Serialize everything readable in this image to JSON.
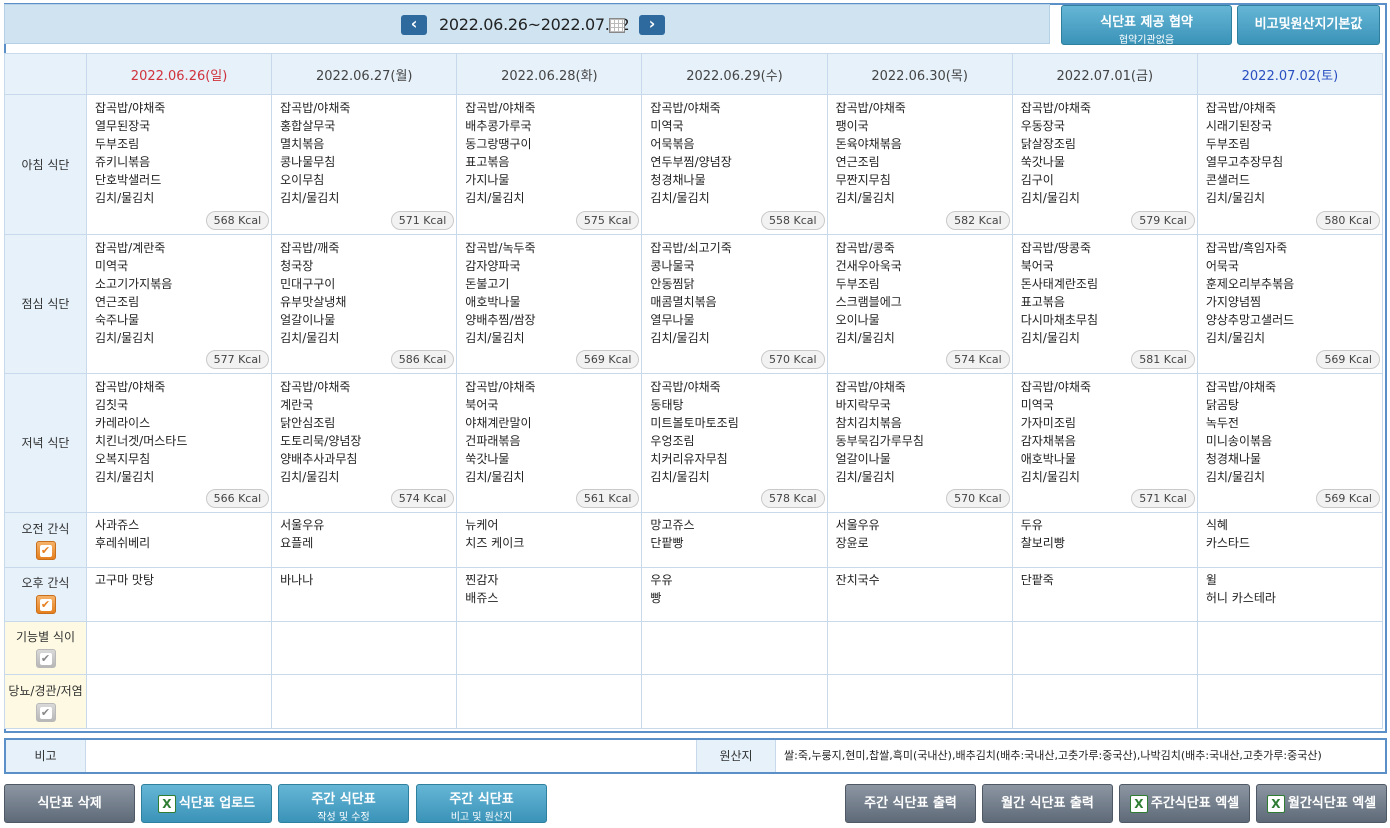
{
  "header": {
    "prev_label": "‹",
    "next_label": "›",
    "date_range": "2022.06.26~2022.07.02",
    "contract_button": {
      "line1": "식단표 제공 협약",
      "line2": "협약기관없음"
    },
    "remarks_default_button": "비고및원산지기본값"
  },
  "days": [
    {
      "label": "2022.06.26(일)",
      "type": "sun"
    },
    {
      "label": "2022.06.27(월)",
      "type": "weekday"
    },
    {
      "label": "2022.06.28(화)",
      "type": "weekday"
    },
    {
      "label": "2022.06.29(수)",
      "type": "weekday"
    },
    {
      "label": "2022.06.30(목)",
      "type": "weekday"
    },
    {
      "label": "2022.07.01(금)",
      "type": "weekday"
    },
    {
      "label": "2022.07.02(토)",
      "type": "sat"
    }
  ],
  "rows": {
    "breakfast": {
      "label": "아침 식단",
      "cells": [
        {
          "items": [
            "잡곡밥/야채죽",
            "열무된장국",
            "두부조림",
            "쥬키니볶음",
            "단호박샐러드",
            "김치/물김치"
          ],
          "kcal": "568 Kcal"
        },
        {
          "items": [
            "잡곡밥/야채죽",
            "홍합살무국",
            "멸치볶음",
            "콩나물무침",
            "오이무침",
            "김치/물김치"
          ],
          "kcal": "571 Kcal"
        },
        {
          "items": [
            "잡곡밥/야채죽",
            "배추콩가루국",
            "동그랑땡구이",
            "표고볶음",
            "가지나물",
            "김치/물김치"
          ],
          "kcal": "575 Kcal"
        },
        {
          "items": [
            "잡곡밥/야채죽",
            "미역국",
            "어묵볶음",
            "연두부찜/양념장",
            "청경채나물",
            "김치/물김치"
          ],
          "kcal": "558 Kcal"
        },
        {
          "items": [
            "잡곡밥/야채죽",
            "팽이국",
            "돈육야채볶음",
            "연근조림",
            "무짠지무침",
            "김치/물김치"
          ],
          "kcal": "582 Kcal"
        },
        {
          "items": [
            "잡곡밥/야채죽",
            "우동장국",
            "닭살장조림",
            "쑥갓나물",
            "김구이",
            "김치/물김치"
          ],
          "kcal": "579 Kcal"
        },
        {
          "items": [
            "잡곡밥/야채죽",
            "시래기된장국",
            "두부조림",
            "열무고추장무침",
            "콘샐러드",
            "김치/물김치"
          ],
          "kcal": "580 Kcal"
        }
      ]
    },
    "lunch": {
      "label": "점심 식단",
      "cells": [
        {
          "items": [
            "잡곡밥/계란죽",
            "미역국",
            "소고기가지볶음",
            "연근조림",
            "숙주나물",
            "김치/물김치"
          ],
          "kcal": "577 Kcal"
        },
        {
          "items": [
            "잡곡밥/깨죽",
            "청국장",
            "민대구구이",
            "유부맛살냉채",
            "얼갈이나물",
            "김치/물김치"
          ],
          "kcal": "586 Kcal"
        },
        {
          "items": [
            "잡곡밥/녹두죽",
            "감자양파국",
            "돈불고기",
            "애호박나물",
            "양배추찜/쌈장",
            "김치/물김치"
          ],
          "kcal": "569 Kcal"
        },
        {
          "items": [
            "잡곡밥/쇠고기죽",
            "콩나물국",
            "안동찜닭",
            "매콤멸치볶음",
            "열무나물",
            "김치/물김치"
          ],
          "kcal": "570 Kcal"
        },
        {
          "items": [
            "잡곡밥/콩죽",
            "건새우아욱국",
            "두부조림",
            "스크램블에그",
            "오이나물",
            "김치/물김치"
          ],
          "kcal": "574 Kcal"
        },
        {
          "items": [
            "잡곡밥/땅콩죽",
            "북어국",
            "돈사태계란조림",
            "표고볶음",
            "다시마채초무침",
            "김치/물김치"
          ],
          "kcal": "581 Kcal"
        },
        {
          "items": [
            "잡곡밥/흑임자죽",
            "어묵국",
            "훈제오리부추볶음",
            "가지양념찜",
            "양상추망고샐러드",
            "김치/물김치"
          ],
          "kcal": "569 Kcal"
        }
      ]
    },
    "dinner": {
      "label": "저녁 식단",
      "cells": [
        {
          "items": [
            "잡곡밥/야채죽",
            "김칫국",
            "카레라이스",
            "치킨너겟/머스타드",
            "오복지무침",
            "김치/물김치"
          ],
          "kcal": "566 Kcal"
        },
        {
          "items": [
            "잡곡밥/야채죽",
            "계란국",
            "닭안심조림",
            "도토리묵/양념장",
            "양배추사과무침",
            "김치/물김치"
          ],
          "kcal": "574 Kcal"
        },
        {
          "items": [
            "잡곡밥/야채죽",
            "북어국",
            "야채계란말이",
            "건파래볶음",
            "쑥갓나물",
            "김치/물김치"
          ],
          "kcal": "561 Kcal"
        },
        {
          "items": [
            "잡곡밥/야채죽",
            "동태탕",
            "미트볼토마토조림",
            "우엉조림",
            "치커리유자무침",
            "김치/물김치"
          ],
          "kcal": "578 Kcal"
        },
        {
          "items": [
            "잡곡밥/야채죽",
            "바지락무국",
            "참치김치볶음",
            "동부묵김가루무침",
            "얼갈이나물",
            "김치/물김치"
          ],
          "kcal": "570 Kcal"
        },
        {
          "items": [
            "잡곡밥/야채죽",
            "미역국",
            "가자미조림",
            "감자채볶음",
            "애호박나물",
            "김치/물김치"
          ],
          "kcal": "571 Kcal"
        },
        {
          "items": [
            "잡곡밥/야채죽",
            "닭곰탕",
            "녹두전",
            "미니송이볶음",
            "청경채나물",
            "김치/물김치"
          ],
          "kcal": "569 Kcal"
        }
      ]
    },
    "am_snack": {
      "label": "오전 간식",
      "checked": true,
      "cells": [
        {
          "items": [
            "사과쥬스",
            "후레쉬베리"
          ]
        },
        {
          "items": [
            "서울우유",
            "요플레"
          ]
        },
        {
          "items": [
            "뉴케어",
            "치즈 케이크"
          ]
        },
        {
          "items": [
            "망고쥬스",
            "단팥빵"
          ]
        },
        {
          "items": [
            "서울우유",
            "장윤로"
          ]
        },
        {
          "items": [
            "두유",
            "찰보리빵"
          ]
        },
        {
          "items": [
            "식혜",
            "카스타드"
          ]
        }
      ]
    },
    "pm_snack": {
      "label": "오후 간식",
      "checked": true,
      "cells": [
        {
          "items": [
            "고구마 맛탕"
          ]
        },
        {
          "items": [
            "바나나"
          ]
        },
        {
          "items": [
            "찐감자",
            "배쥬스"
          ]
        },
        {
          "items": [
            "우유",
            "빵"
          ]
        },
        {
          "items": [
            "잔치국수"
          ]
        },
        {
          "items": [
            "단팥죽"
          ]
        },
        {
          "items": [
            "윌",
            "허니 카스테라"
          ]
        }
      ]
    },
    "functional": {
      "label": "기능별 식이",
      "checked": false
    },
    "diabetes": {
      "label": "당뇨/경관/저염",
      "checked": false
    }
  },
  "remarks": {
    "label": "비고",
    "value": "",
    "origin_label": "원산지",
    "origin_value": "쌀:죽,누룽지,현미,찹쌀,흑미(국내산),배추김치(배추:국내산,고춧가루:중국산),나박김치(배추:국내산,고춧가루:중국산)"
  },
  "footer": {
    "delete": "식단표 삭제",
    "upload": "식단표 업로드",
    "weekly_edit": {
      "line1": "주간 식단표",
      "line2": "작성 및 수정"
    },
    "weekly_remarks": {
      "line1": "주간 식단표",
      "line2": "비고 및 원산지"
    },
    "weekly_print": "주간 식단표 출력",
    "monthly_print": "월간 식단표 출력",
    "weekly_excel": "주간식단표 엑셀",
    "monthly_excel": "월간식단표 엑셀"
  },
  "colors": {
    "accent": "#3a93b8",
    "frame": "#5a8fc8",
    "sunday": "#d0323c",
    "saturday": "#2a4fc0"
  }
}
